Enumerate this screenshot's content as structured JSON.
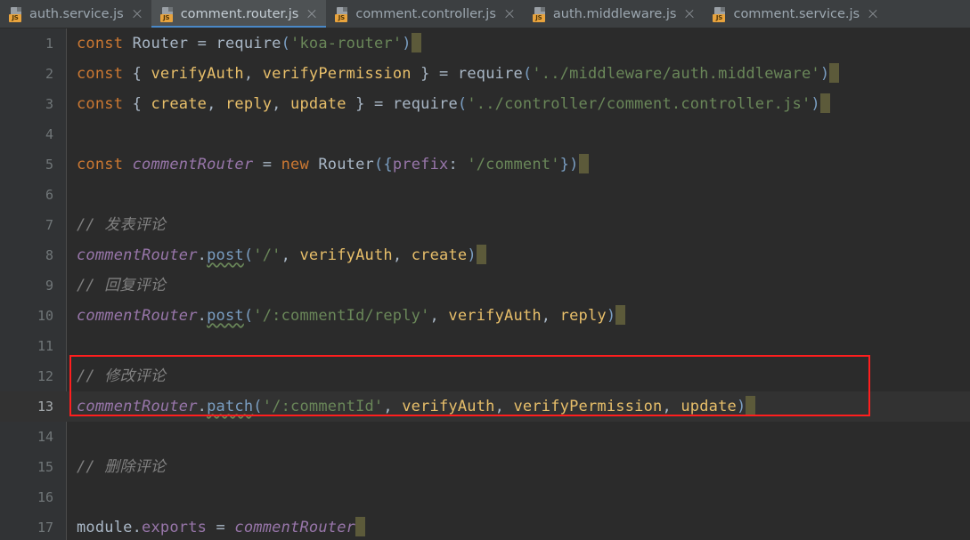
{
  "window": {
    "app": "code-editor",
    "theme_colors": {
      "editor_background": "#2b2b2b",
      "gutter_background": "#313335",
      "tabbar_background": "#3c3f41",
      "active_tab_background": "#4e5254",
      "active_tab_underline": "#4a88c7",
      "current_line_background": "#323232",
      "annotation_red": "#ff1e1e",
      "keyword": "#cc7832",
      "string": "#6a8759",
      "comment": "#808080",
      "variable": "#9876aa",
      "function": "#7a9ec2",
      "parameter": "#e8bf6a",
      "default_text": "#a9b7c6",
      "caret_block": "#5c5a3a"
    }
  },
  "tabs": [
    {
      "label": "auth.service.js",
      "icon": "js-file-icon",
      "badge": "JS",
      "close_icon": "close-icon",
      "active": false
    },
    {
      "label": "comment.router.js",
      "icon": "js-file-icon",
      "badge": "JS",
      "close_icon": "close-icon",
      "active": true
    },
    {
      "label": "comment.controller.js",
      "icon": "js-file-icon",
      "badge": "JS",
      "close_icon": "close-icon",
      "active": false
    },
    {
      "label": "auth.middleware.js",
      "icon": "js-file-icon",
      "badge": "JS",
      "close_icon": "close-icon",
      "active": false
    },
    {
      "label": "comment.service.js",
      "icon": "js-file-icon",
      "badge": "JS",
      "close_icon": "close-icon",
      "active": false
    }
  ],
  "editor": {
    "active_file": "comment.router.js",
    "language": "javascript",
    "current_line": 13,
    "line_numbers": [
      "1",
      "2",
      "3",
      "4",
      "5",
      "6",
      "7",
      "8",
      "9",
      "10",
      "11",
      "12",
      "13",
      "14",
      "15",
      "16",
      "17"
    ],
    "lines": [
      {
        "n": "1",
        "text": "const Router = require('koa-router')"
      },
      {
        "n": "2",
        "text": "const { verifyAuth, verifyPermission } = require('../middleware/auth.middleware')"
      },
      {
        "n": "3",
        "text": "const { create, reply, update } = require('../controller/comment.controller.js')"
      },
      {
        "n": "4",
        "text": ""
      },
      {
        "n": "5",
        "text": "const commentRouter = new Router({prefix: '/comment'})"
      },
      {
        "n": "6",
        "text": ""
      },
      {
        "n": "7",
        "text": "// 发表评论"
      },
      {
        "n": "8",
        "text": "commentRouter.post('/', verifyAuth, create)"
      },
      {
        "n": "9",
        "text": "// 回复评论"
      },
      {
        "n": "10",
        "text": "commentRouter.post('/:commentId/reply', verifyAuth, reply)"
      },
      {
        "n": "11",
        "text": ""
      },
      {
        "n": "12",
        "text": "// 修改评论"
      },
      {
        "n": "13",
        "text": "commentRouter.patch('/:commentId', verifyAuth, verifyPermission, update)"
      },
      {
        "n": "14",
        "text": ""
      },
      {
        "n": "15",
        "text": "// 删除评论"
      },
      {
        "n": "16",
        "text": ""
      },
      {
        "n": "17",
        "text": "module.exports = commentRouter"
      }
    ],
    "tokens": {
      "kw_const": "const",
      "kw_new": "new",
      "id_Router": "Router",
      "fn_require": "require",
      "str_koa_router": "'koa-router'",
      "str_auth_middleware": "'../middleware/auth.middleware'",
      "str_comment_controller": "'../controller/comment.controller.js'",
      "id_verifyAuth": "verifyAuth",
      "id_verifyPermission": "verifyPermission",
      "id_create": "create",
      "id_reply": "reply",
      "id_update": "update",
      "var_commentRouter": "commentRouter",
      "prop_prefix": "prefix",
      "str_comment_prefix": "'/comment'",
      "m_post": "post",
      "m_patch": "patch",
      "str_slash": "'/'",
      "str_commentid_reply": "'/:commentId/reply'",
      "str_commentid": "'/:commentId'",
      "id_module": "module",
      "prop_exports": "exports",
      "comment_publish": "// 发表评论",
      "comment_reply": "// 回复评论",
      "comment_modify": "// 修改评论",
      "comment_delete": "// 删除评论"
    }
  },
  "annotation": {
    "type": "red-rectangle-highlight",
    "highlights_lines": "12-13"
  }
}
